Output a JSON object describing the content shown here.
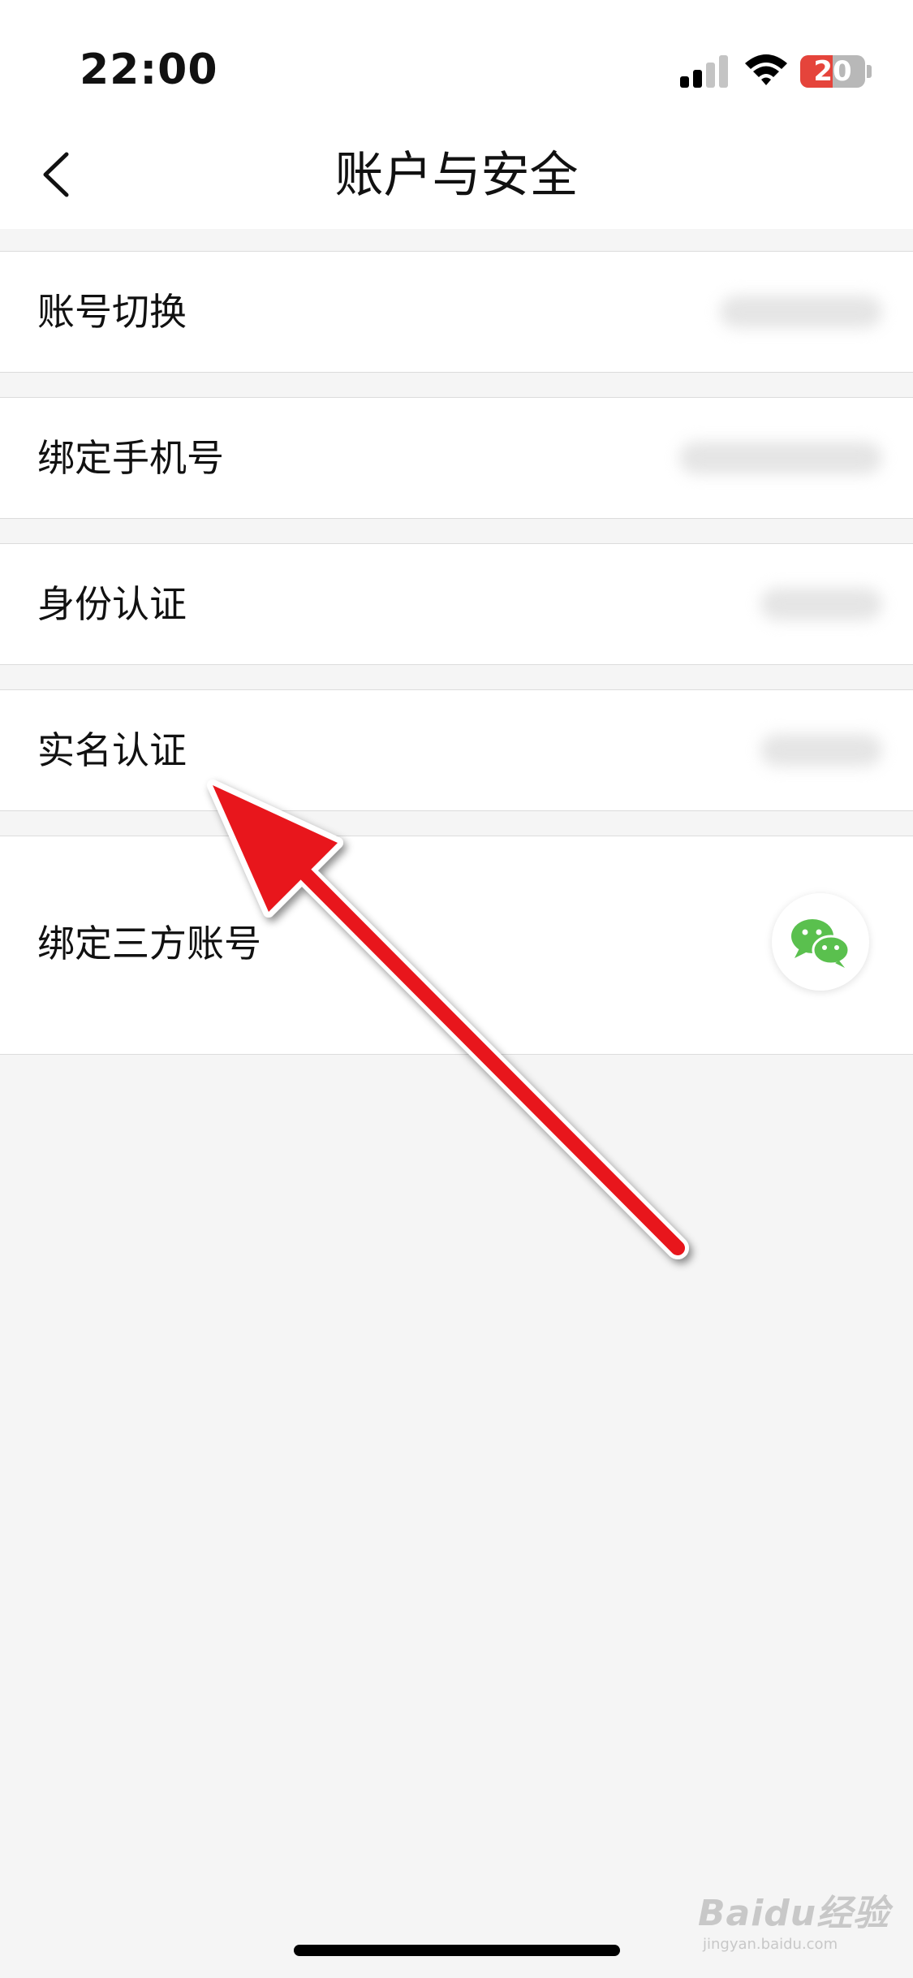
{
  "status_bar": {
    "time": "22:00",
    "battery_level": "20",
    "battery_fraction": 0.2
  },
  "nav": {
    "title": "账户与安全",
    "back_icon": "chevron-left-icon"
  },
  "rows": [
    {
      "label": "账号切换",
      "value_hidden": true
    },
    {
      "label": "绑定手机号",
      "value_hidden": true
    },
    {
      "label": "身份认证",
      "value_hidden": true
    },
    {
      "label": "实名认证",
      "value_hidden": true
    },
    {
      "label": "绑定三方账号",
      "icon": "wechat-icon"
    }
  ],
  "annotation": {
    "type": "red-arrow",
    "color": "#e8171f",
    "points_to": "实名认证"
  },
  "watermark": {
    "text": "Baidu经验",
    "sub": "jingyan.baidu.com"
  },
  "colors": {
    "background": "#f5f5f5",
    "wechat_green": "#5ac04e",
    "battery_red": "#e5443b"
  }
}
